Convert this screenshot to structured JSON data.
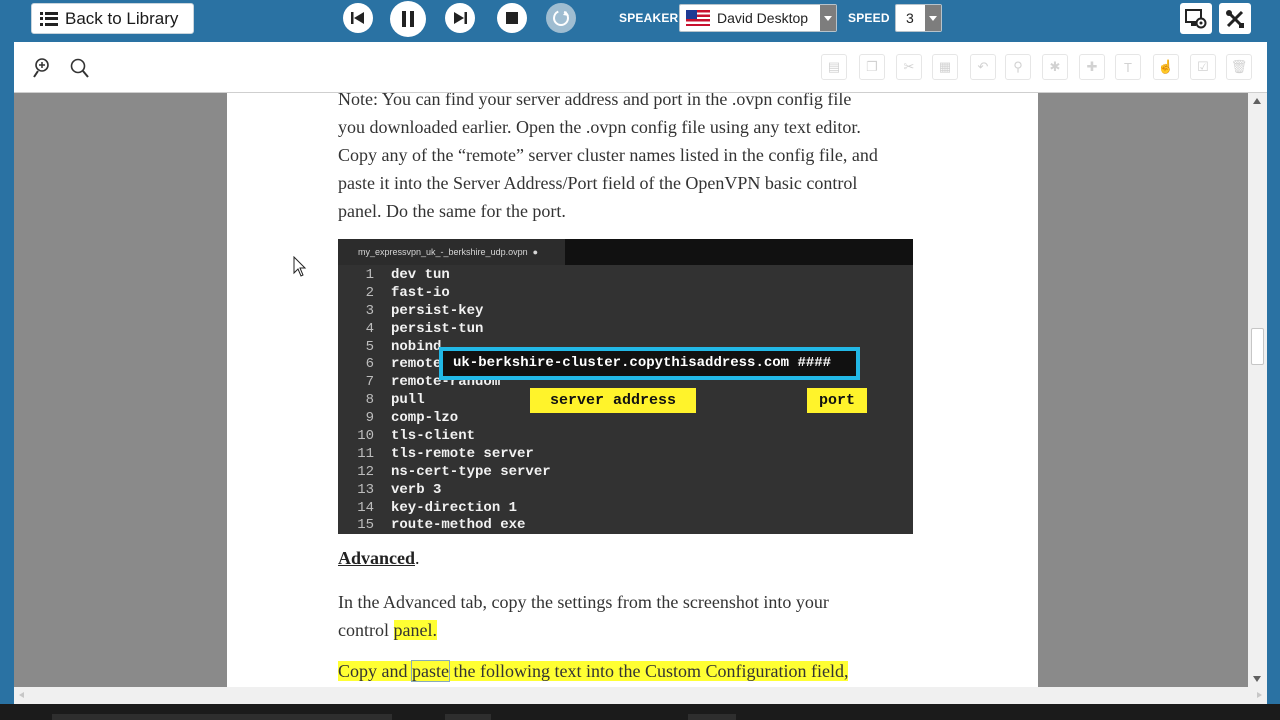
{
  "toolbar": {
    "back_label": "Back to Library",
    "speaker_label": "SPEAKER",
    "speaker_value": "David Desktop",
    "speed_label": "SPEED",
    "speed_value": "3"
  },
  "colors": {
    "toolbar_bg": "#2a72a3",
    "highlight": "#ffff33",
    "callout_border": "#22b8e6",
    "tag_bg": "#fff32b"
  },
  "icons": {
    "back": "list-icon",
    "prev": "skip-back-icon",
    "pause": "pause-icon",
    "next": "skip-forward-icon",
    "stop": "stop-icon",
    "repeat": "repeat-icon",
    "settings": "screen-settings-icon",
    "tools": "tools-icon",
    "zoom_in": "zoom-in-icon",
    "zoom_out": "zoom-out-icon"
  },
  "document": {
    "note_lines": [
      "Note: You can find your server address and port in the .ovpn config file",
      "you downloaded earlier. Open the .ovpn config file using any text editor.",
      "Copy any of the “remote” server cluster names listed in the config file, and",
      "paste it into the Server Address/Port field of the OpenVPN basic control",
      "panel. Do the same for the port."
    ],
    "image": {
      "tab_title": "my_expressvpn_uk_-_berkshire_udp.ovpn",
      "lines": [
        {
          "n": "1",
          "t": "dev tun"
        },
        {
          "n": "2",
          "t": "fast-io"
        },
        {
          "n": "3",
          "t": "persist-key"
        },
        {
          "n": "4",
          "t": "persist-tun"
        },
        {
          "n": "5",
          "t": "nobind"
        },
        {
          "n": "6",
          "t": "remote"
        },
        {
          "n": "7",
          "t": "remote-random"
        },
        {
          "n": "8",
          "t": "pull"
        },
        {
          "n": "9",
          "t": "comp-lzo"
        },
        {
          "n": "10",
          "t": "tls-client"
        },
        {
          "n": "11",
          "t": "tls-remote server"
        },
        {
          "n": "12",
          "t": "ns-cert-type server"
        },
        {
          "n": "13",
          "t": "verb 3"
        },
        {
          "n": "14",
          "t": "key-direction 1"
        },
        {
          "n": "15",
          "t": "route-method exe"
        }
      ],
      "callout": "uk-berkshire-cluster.copythisaddress.com ####",
      "tag_address": "server address",
      "tag_port": "port"
    },
    "heading": "Advanced",
    "heading_period": ".",
    "advanced_line1": "In the Advanced tab, copy the settings from the screenshot into your",
    "advanced_line2_a": "control ",
    "advanced_line2_b": "panel.",
    "copy_a": "Copy and ",
    "copy_b": "paste",
    "copy_c": " the following text into the Custom Configuration field,"
  }
}
